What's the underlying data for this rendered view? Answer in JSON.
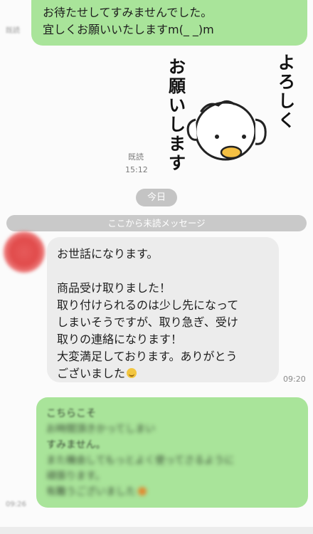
{
  "top_message": {
    "lines": [
      "お待たせしてすみませんでした。",
      "宜しくお願いいたしますm(_ _)m"
    ],
    "side_meta": "既読"
  },
  "sticker": {
    "text_right": "よろしく",
    "text_left": "お願いします",
    "icon": "duck-sticker-icon"
  },
  "read_receipt": {
    "label": "既読",
    "time": "15:12"
  },
  "date_separator": "今日",
  "unread_separator": "ここから未読メッセージ",
  "incoming_message": {
    "lines": [
      "お世話になります。",
      "",
      "商品受け取りました！",
      "取り付けられるのは少し先になって",
      "しまいそうですが、取り急ぎ、受け",
      "取りの連絡になります！",
      "大変満足しております。ありがとう",
      "ございました"
    ],
    "emoji": "smile-emoji-icon",
    "time": "09:20"
  },
  "reply_message": {
    "lines": [
      "こちらこそ",
      "お時間頂きかってしまい",
      "すみません。",
      "また機会してもっとよく使ってさるように",
      "頑張ります。",
      "有難うございました"
    ],
    "emoji": "flower-emoji-icon",
    "time": "09:26"
  },
  "colors": {
    "outgoing_bubble": "#a9e49a",
    "incoming_bubble": "#ececec",
    "pill": "#c4c4c4",
    "background": "#fbfbfb"
  }
}
